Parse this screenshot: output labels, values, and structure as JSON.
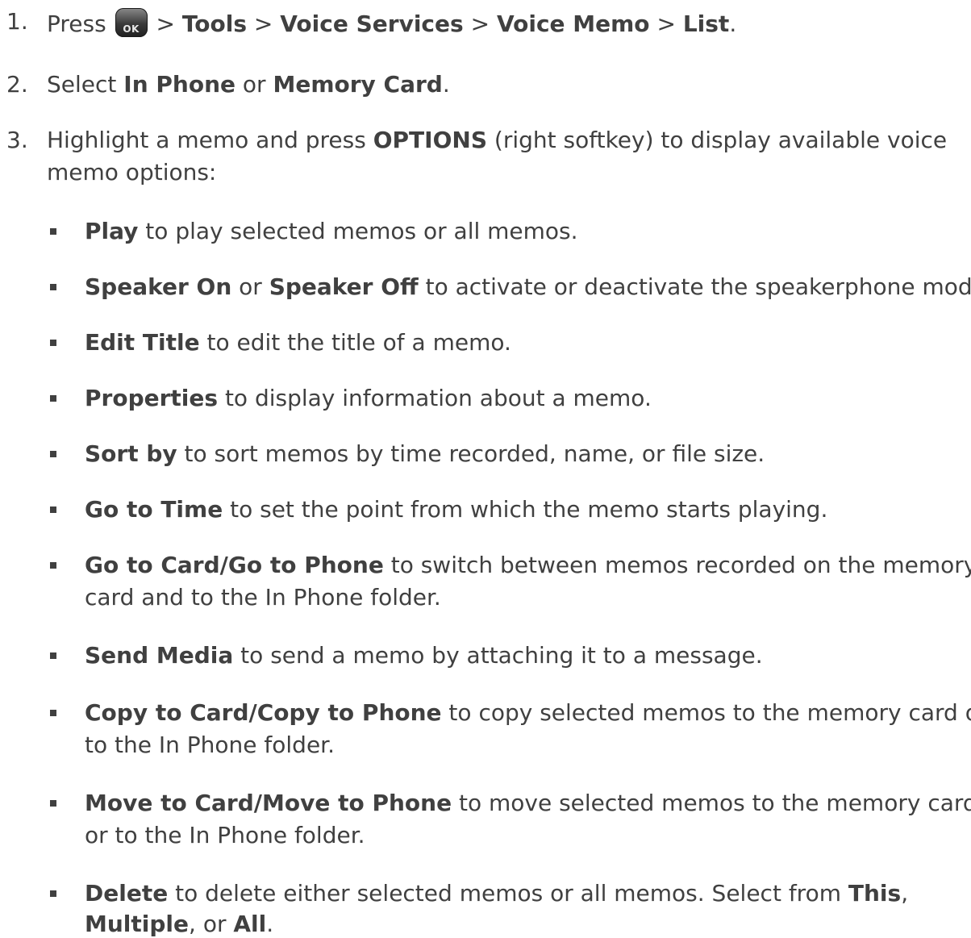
{
  "steps": [
    {
      "number": "1.",
      "parts": [
        "Press",
        "OK",
        ">",
        "Tools",
        ">",
        "Voice Services",
        ">",
        "Voice Memo",
        ">",
        "List",
        "."
      ]
    },
    {
      "number": "2.",
      "parts": [
        "Select",
        "In Phone",
        "or",
        "Memory Card",
        "."
      ]
    },
    {
      "number": "3.",
      "line1": [
        "Highlight a memo and press",
        "OPTIONS",
        "(right softkey) to display available voice"
      ],
      "line2": "memo options:"
    }
  ],
  "options": [
    {
      "bold": "Play",
      "text": " to play selected memos or all memos."
    },
    {
      "bold": "Speaker On",
      "mid": " or ",
      "bold2": "Speaker Off",
      "text": " to activate or deactivate the speakerphone mode."
    },
    {
      "bold": "Edit Title",
      "text": " to edit the title of a memo."
    },
    {
      "bold": "Properties",
      "text": " to display information about a memo."
    },
    {
      "bold": "Sort by",
      "text": " to sort memos by time recorded, name, or file size."
    },
    {
      "bold": "Go to Time",
      "text": " to set the point from which the memo starts playing."
    },
    {
      "bold": "Go to Card/Go to Phone",
      "text": " to switch between memos recorded on the memory",
      "cont": "card and to the In Phone folder."
    },
    {
      "bold": "Send Media",
      "text": " to send a memo by attaching it to a message."
    },
    {
      "bold": "Copy to Card/Copy to Phone",
      "text": " to copy selected memos to the memory card or",
      "cont": "to the In Phone folder."
    },
    {
      "bold": "Move to Card/Move to Phone",
      "text": " to move selected memos to the memory card",
      "cont": "or to the In Phone folder."
    },
    {
      "bold": "Delete",
      "text": " to delete either selected memos or all memos. Select from ",
      "bold3": "This",
      "text3": ",",
      "cont_bold1": "Multiple",
      "cont_mid": ", or ",
      "cont_bold2": "All",
      "cont_end": "."
    }
  ]
}
